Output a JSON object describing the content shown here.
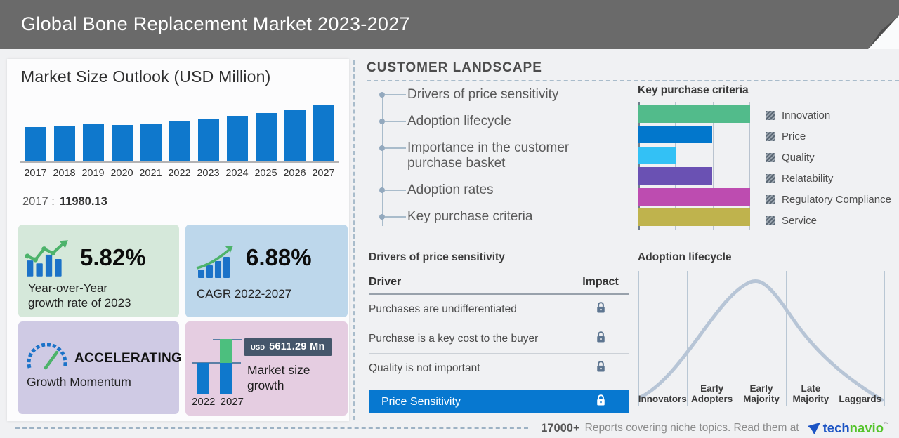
{
  "colors": {
    "header_bg": "#6a6a6a",
    "bar_blue": "#0f78cc",
    "green_card": "#d5e8da",
    "blue_card": "#bdd7eb",
    "purple_card": "#cfcae4",
    "pink_card": "#e5cde1",
    "highlight_blue": "#0778d0",
    "growth_green": "#4cbf7e",
    "badge_bg": "#45566b",
    "curve": "#b7c5d6",
    "logo_blue": "#1c54c4",
    "logo_green": "#55c42c"
  },
  "header": {
    "title": "Global Bone Replacement Market 2023-2027"
  },
  "market_outlook": {
    "title": "Market Size Outlook (USD Million)",
    "callout_label": "2017 :",
    "callout_value": "11980.13"
  },
  "cards": {
    "yoy": {
      "value": "5.82%",
      "label": "Year-over-Year\ngrowth rate of 2023"
    },
    "cagr": {
      "value": "6.88%",
      "label": "CAGR 2022-2027"
    },
    "momentum": {
      "value": "ACCELERATING",
      "label": "Growth Momentum"
    },
    "growth": {
      "currency": "USD",
      "amount": "5611.29 Mn",
      "label": "Market size\ngrowth",
      "years": [
        "2022",
        "2027"
      ]
    }
  },
  "customer_landscape": {
    "title": "CUSTOMER LANDSCAPE",
    "items": [
      "Drivers of price sensitivity",
      "Adoption lifecycle",
      "Importance in the customer purchase basket",
      "Adoption rates",
      "Key purchase criteria"
    ]
  },
  "key_purchase_criteria": {
    "title": "Key purchase criteria",
    "items": [
      {
        "label": "Innovation",
        "color": "#52bb8b",
        "pct": 100
      },
      {
        "label": "Price",
        "color": "#0277cc",
        "pct": 66
      },
      {
        "label": "Quality",
        "color": "#33c1f5",
        "pct": 34
      },
      {
        "label": "Relatability",
        "color": "#6a51b3",
        "pct": 66
      },
      {
        "label": "Regulatory Compliance",
        "color": "#bd4cb0",
        "pct": 100
      },
      {
        "label": "Service",
        "color": "#bfb34d",
        "pct": 100
      }
    ]
  },
  "price_sensitivity": {
    "title": "Drivers of price sensitivity",
    "columns": {
      "driver": "Driver",
      "impact": "Impact"
    },
    "rows": [
      "Purchases are undifferentiated",
      "Purchase is a key cost to the buyer",
      "Quality is not important"
    ],
    "highlight": "Price Sensitivity"
  },
  "adoption_lifecycle": {
    "title": "Adoption lifecycle",
    "stages": [
      "Innovators",
      "Early Adopters",
      "Early Majority",
      "Late Majority",
      "Laggards"
    ]
  },
  "footer": {
    "count": "17000+",
    "text": "Reports covering niche topics. Read them at",
    "logo": {
      "tech": "tech",
      "navio": "navio",
      "tm": "™"
    }
  },
  "chart_data": [
    {
      "type": "bar",
      "title": "Market Size Outlook (USD Million)",
      "categories": [
        "2017",
        "2018",
        "2019",
        "2020",
        "2021",
        "2022",
        "2023",
        "2024",
        "2025",
        "2026",
        "2027"
      ],
      "values": [
        11980.13,
        12460,
        13280,
        12790,
        13120,
        14018,
        14834,
        15980,
        16870,
        18260,
        19629
      ],
      "xlabel": "Year",
      "ylabel": "USD Million",
      "ylim": [
        0,
        19700
      ],
      "grid": true,
      "annotations": {
        "2017": "11980.13",
        "yoy_growth_2023": "5.82%",
        "cagr_2022_2027": "6.88%"
      }
    },
    {
      "type": "bar",
      "title": "Key purchase criteria",
      "orientation": "horizontal",
      "categories": [
        "Innovation",
        "Price",
        "Quality",
        "Relatability",
        "Regulatory Compliance",
        "Service"
      ],
      "values": [
        100,
        66,
        34,
        66,
        100,
        100
      ],
      "value_units": "percent of axis (qualitative importance)",
      "legend_position": "right",
      "grid": true
    },
    {
      "type": "bar",
      "title": "Market size growth",
      "categories": [
        "2022",
        "2027"
      ],
      "values": [
        14018,
        19629.29
      ],
      "annotations": {
        "incremental_growth": "USD 5611.29 Mn"
      }
    },
    {
      "type": "line",
      "title": "Adoption lifecycle",
      "categories": [
        "Innovators",
        "Early Adopters",
        "Early Majority",
        "Late Majority",
        "Laggards"
      ],
      "shape": "bell curve, peak within Early Majority",
      "grid": true
    }
  ]
}
